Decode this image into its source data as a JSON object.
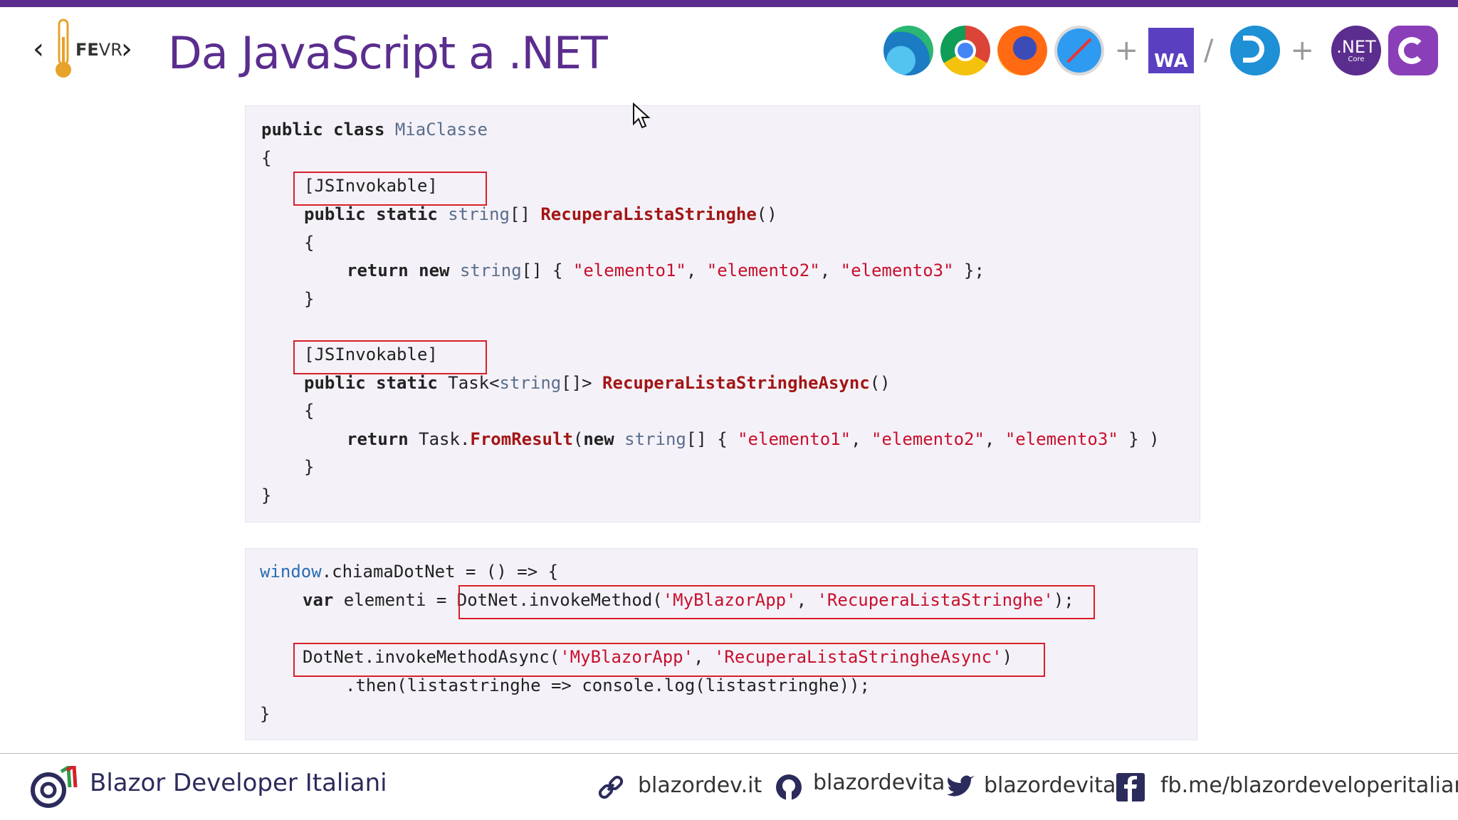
{
  "header": {
    "title": "Da JavaScript a .NET",
    "logo_text_fe": "FE",
    "logo_text_vr": "VR",
    "plus_sign": "+",
    "slash_sign": "/",
    "wa_label": "WA",
    "net_label": ".NET",
    "net_sub": "Core"
  },
  "icons": [
    "edge-icon",
    "chrome-icon",
    "firefox-icon",
    "safari-icon",
    "webassembly-icon",
    "razor-icon",
    "dotnet-core-icon",
    "csharp-icon"
  ],
  "code_csharp": {
    "l1_kw": "public class ",
    "l1_type": "MiaClasse",
    "l2": "{",
    "attr1": "[JSInvokable]",
    "l4_kw": "public static ",
    "l4_type": "string",
    "l4_br": "[] ",
    "l4_fn": "RecuperaListaStringhe",
    "l4_end": "()",
    "l5": "{",
    "l6_kw": "return new ",
    "l6_type": "string",
    "l6_mid": "[] { ",
    "s1": "\"elemento1\"",
    "comma": ", ",
    "s2": "\"elemento2\"",
    "s3": "\"elemento3\"",
    "l6_end": " };",
    "l7": "}",
    "attr2": "[JSInvokable]",
    "l10_kw": "public static ",
    "l10_task": "Task<",
    "l10_type": "string",
    "l10_br": "[]> ",
    "l10_fn": "RecuperaListaStringheAsync",
    "l10_end": "()",
    "l11": "{",
    "l12_kw": "return ",
    "l12_task": "Task.",
    "l12_fn": "FromResult",
    "l12_paren": "(",
    "l12_new": "new ",
    "l12_type": "string",
    "l12_mid": "[] { ",
    "l12_end": " } )",
    "l13": "}",
    "l14": "}"
  },
  "code_js": {
    "l1_win": "window",
    "l1_rest": ".chiamaDotNet = () => {",
    "l2_kw": "var ",
    "l2_rest": "elementi = ",
    "l2_call": "DotNet.invokeMethod(",
    "l2_s1": "'MyBlazorApp'",
    "l2_comma": ", ",
    "l2_s2": "'RecuperaListaStringhe'",
    "l2_end": ");",
    "l4_call": "DotNet.invokeMethodAsync(",
    "l4_s1": "'MyBlazorApp'",
    "l4_comma": ", ",
    "l4_s2": "'RecuperaListaStringheAsync'",
    "l4_end": ")",
    "l5": ".then(listastringhe => console.log(listastringhe));",
    "l6": "}"
  },
  "footer": {
    "brand": "Blazor Developer Italiani",
    "site": "blazordev.it",
    "github": "blazordevita",
    "twitter": "blazordevita",
    "facebook": "fb.me/blazordeveloperitaliani"
  },
  "colors": {
    "accent": "#5b2d8e",
    "highlight_box": "#d81f2a",
    "string": "#c8102e"
  }
}
